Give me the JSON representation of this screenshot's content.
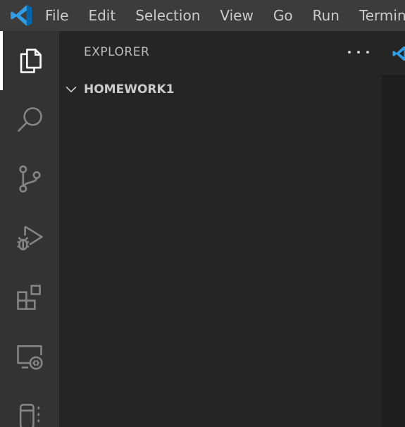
{
  "menubar": {
    "logo_icon": "vscode-logo-icon",
    "items": [
      "File",
      "Edit",
      "Selection",
      "View",
      "Go",
      "Run",
      "Terminal"
    ]
  },
  "activitybar": {
    "items": [
      {
        "name": "explorer",
        "icon": "files-icon",
        "active": true
      },
      {
        "name": "search",
        "icon": "search-icon",
        "active": false
      },
      {
        "name": "source-control",
        "icon": "source-control-icon",
        "active": false
      },
      {
        "name": "run-debug",
        "icon": "run-debug-icon",
        "active": false
      },
      {
        "name": "extensions",
        "icon": "extensions-icon",
        "active": false
      },
      {
        "name": "remote-explorer",
        "icon": "remote-explorer-icon",
        "active": false
      },
      {
        "name": "testing",
        "icon": "beaker-icon",
        "active": false
      }
    ]
  },
  "sidebar": {
    "title": "EXPLORER",
    "more_actions_icon": "ellipsis-icon",
    "folder": {
      "name": "HOMEWORK1",
      "expanded": true,
      "icon": "chevron-down-icon"
    }
  },
  "colors": {
    "menubar_bg": "#3c3c3c",
    "activitybar_bg": "#333333",
    "sidebar_bg": "#252526",
    "editor_bg": "#1e1e1e",
    "accent": "#007acc",
    "foreground": "#cccccc"
  }
}
